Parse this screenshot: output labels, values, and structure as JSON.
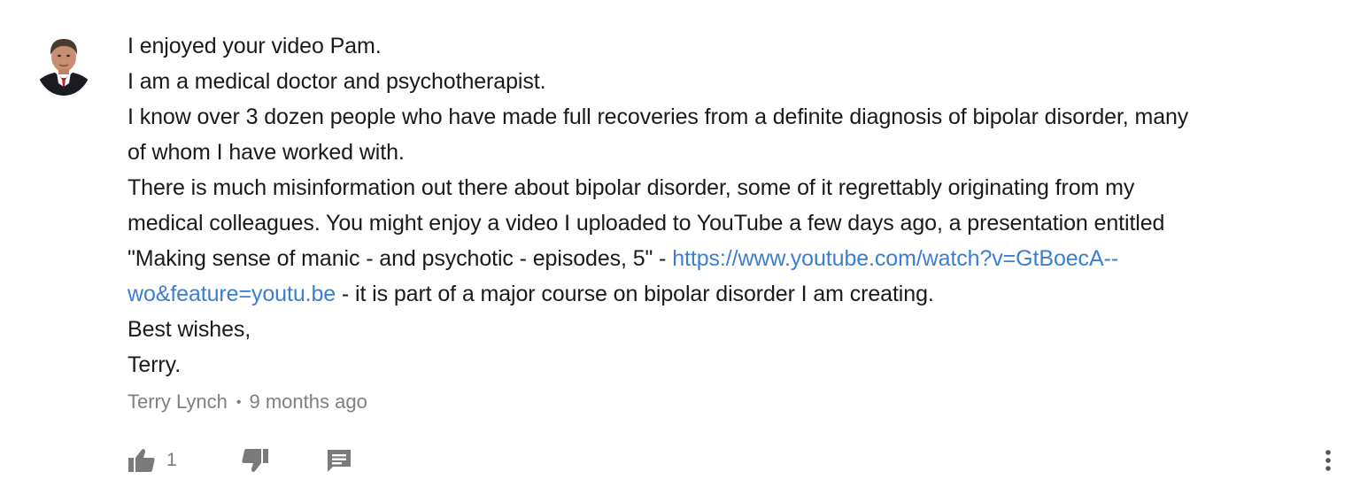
{
  "comment": {
    "lines": [
      "I enjoyed your video Pam.",
      "I am a medical doctor and psychotherapist.",
      "I know over 3 dozen people who have made full recoveries from a definite diagnosis of bipolar disorder, many",
      "of whom I have worked with.",
      "There is much misinformation out there about bipolar disorder, some of it regrettably originating from my",
      "medical colleagues. You might enjoy a video I uploaded to YouTube a few days ago, a presentation entitled",
      "\"Making sense of manic - and psychotic - episodes, 5\"  - ",
      "https://www.youtube.com/watch?v=GtBoecA--",
      "wo&feature=youtu.be",
      " -  it is part of a major course on bipolar disorder I am creating.",
      "Best wishes,",
      "Terry."
    ],
    "author": "Terry Lynch",
    "separator": "•",
    "timestamp": "9 months ago",
    "like_count": "1"
  },
  "icons": {
    "like": "thumbs-up-icon",
    "dislike": "thumbs-down-icon",
    "reply": "comment-icon",
    "more": "more-vertical-icon"
  },
  "colors": {
    "text": "#1a1a1a",
    "link": "#3a7fd4",
    "meta": "#808080",
    "icon": "#7a7a7a"
  }
}
